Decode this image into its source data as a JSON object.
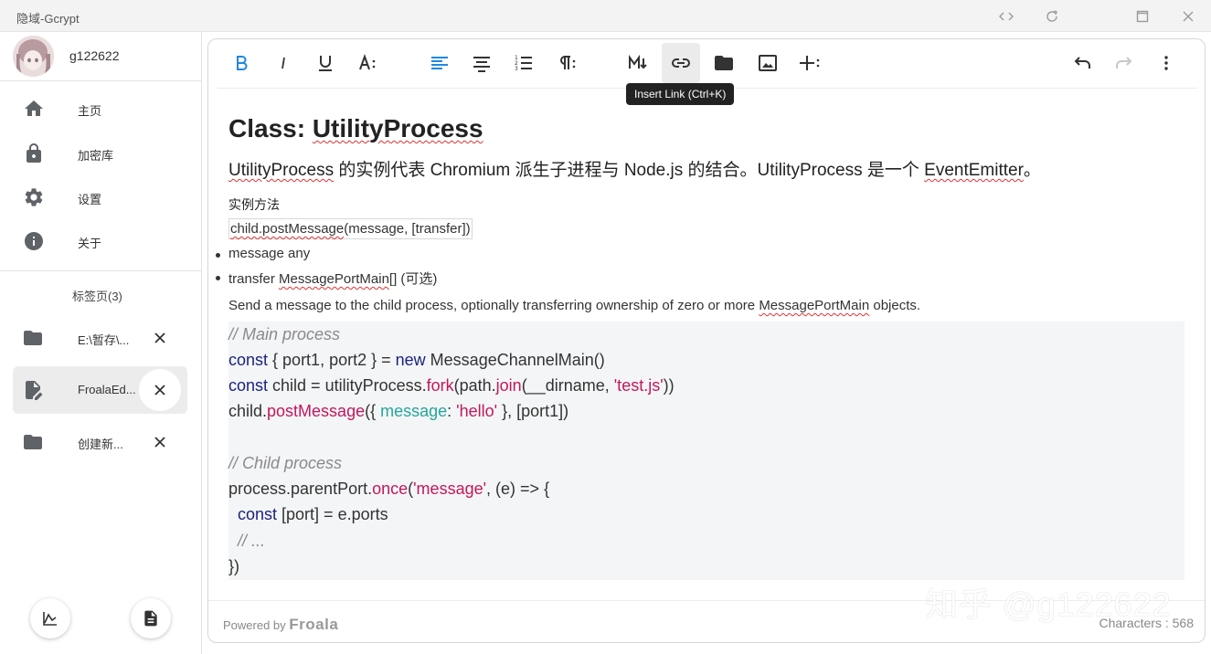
{
  "window": {
    "title": "隐域-Gcrypt"
  },
  "user": {
    "name": "g122622"
  },
  "nav": {
    "home": "主页",
    "vault": "加密库",
    "settings": "设置",
    "about": "关于"
  },
  "tabs": {
    "header": "标签页(3)",
    "items": [
      {
        "label": "E:\\暂存\\...",
        "icon": "folder-icon"
      },
      {
        "label": "FroalaEd...",
        "icon": "edit-document-icon",
        "active": true
      },
      {
        "label": "创建新...",
        "icon": "folder-icon"
      }
    ]
  },
  "toolbar": {
    "tooltip": "Insert Link (Ctrl+K)",
    "accent_color": "#1e88e5"
  },
  "document": {
    "title_prefix": "Class: ",
    "title_name": "UtilityProcess",
    "intro_link1": "UtilityProcess",
    "intro_mid": " 的实例代表 Chromium 派生子进程与 Node.js 的结合。UtilityProcess 是一个 ",
    "intro_link2": "EventEmitter",
    "intro_end": "。",
    "subheading": "实例方法",
    "method_name": "child.postMessage",
    "method_args": "(message, [transfer])",
    "bullet1": "message any",
    "bullet2_prefix": "transfer ",
    "bullet2_link": "MessagePortMain",
    "bullet2_suffix": "[] (可选)",
    "desc_prefix": "Send a message to the child process, optionally transferring ownership of zero or more ",
    "desc_link": "MessagePortMain",
    "desc_suffix": " objects."
  },
  "code": {
    "l1": "// Main process",
    "l2_kw": "const",
    "l2_a": " { port1, port2 } = ",
    "l2_kw2": "new",
    "l2_b": " MessageChannelMain()",
    "l3_kw": "const",
    "l3_a": " child = utilityProcess.",
    "l3_fn": "fork",
    "l3_b": "(path.",
    "l3_fn2": "join",
    "l3_c": "(__dirname, ",
    "l3_str": "'test.js'",
    "l3_d": "))",
    "l4_a": "child.",
    "l4_fn": "postMessage",
    "l4_b": "({ ",
    "l4_prop": "message",
    "l4_c": ": ",
    "l4_str": "'hello'",
    "l4_d": " }, [port1])",
    "l6": "// Child process",
    "l7_a": "process.parentPort.",
    "l7_fn": "once",
    "l7_b": "(",
    "l7_str": "'message'",
    "l7_c": ", (e) => {",
    "l8_kw": "  const",
    "l8_a": " [port] = e.ports",
    "l9": "  // ...",
    "l10": "})"
  },
  "footer": {
    "powered_by": "Powered by ",
    "brand": "Froala",
    "characters": "Characters : 568"
  },
  "watermark": "知乎 @g122622"
}
